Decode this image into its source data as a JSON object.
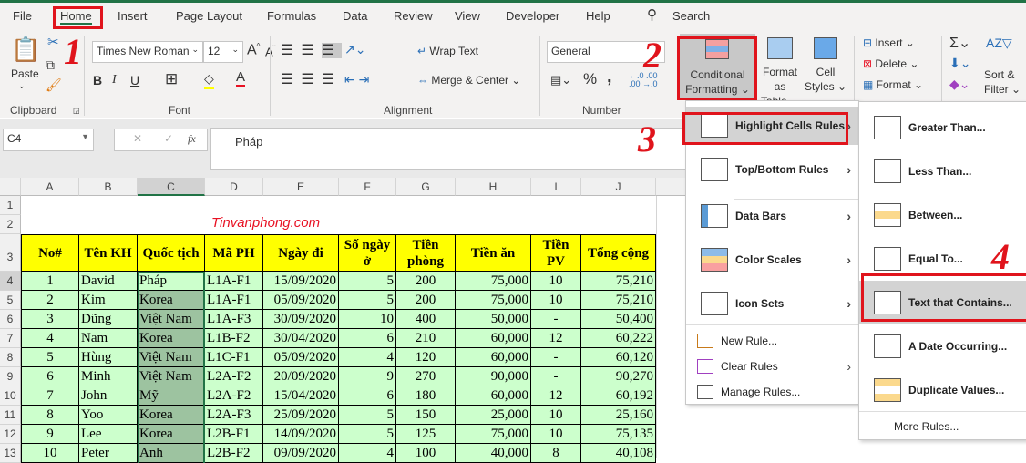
{
  "tabs": [
    "File",
    "Home",
    "Insert",
    "Page Layout",
    "Formulas",
    "Data",
    "Review",
    "View",
    "Developer",
    "Help"
  ],
  "search": "Search",
  "ribbon": {
    "paste": "Paste",
    "clipboard": "Clipboard",
    "font_name": "Times New Roman",
    "font_size": "12",
    "font": "Font",
    "wrap_text": "Wrap Text",
    "merge_center": "Merge & Center",
    "alignment": "Alignment",
    "number_format": "General",
    "number": "Number",
    "conditional_formatting": [
      "Conditional",
      "Formatting"
    ],
    "format_as_table": [
      "Format as",
      "Table"
    ],
    "cell_styles": [
      "Cell",
      "Styles"
    ],
    "insert": "Insert",
    "delete": "Delete",
    "format": "Format",
    "sort_filter": [
      "Sort &",
      "Filter"
    ],
    "bold": "B",
    "italic": "I",
    "underline": "U",
    "percent": "%",
    "comma": ","
  },
  "annotations": [
    "1",
    "2",
    "3",
    "4"
  ],
  "formula_bar": {
    "name_box": "C4",
    "fx": "fx",
    "value": "Pháp"
  },
  "sheet": {
    "columns": [
      "A",
      "B",
      "C",
      "D",
      "E",
      "F",
      "G",
      "H",
      "I",
      "J"
    ],
    "row_numbers": [
      "1",
      "2",
      "3",
      "4",
      "5",
      "6",
      "7",
      "8",
      "9",
      "10",
      "11",
      "12",
      "13"
    ],
    "watermark": "Tinvanphong.com",
    "headers": [
      "No#",
      "Tên KH",
      "Quốc tịch",
      "Mã PH",
      "Ngày đi",
      "Số ngày ở",
      "Tiền phòng",
      "Tiền ăn",
      "Tiền PV",
      "Tổng cộng"
    ],
    "rows": [
      [
        "1",
        "David",
        "Pháp",
        "L1A-F1",
        "15/09/2020",
        "5",
        "200",
        "75,000",
        "10",
        "75,210"
      ],
      [
        "2",
        "Kim",
        "Korea",
        "L1A-F1",
        "05/09/2020",
        "5",
        "200",
        "75,000",
        "10",
        "75,210"
      ],
      [
        "3",
        "Dũng",
        "Việt Nam",
        "L1A-F3",
        "30/09/2020",
        "10",
        "400",
        "50,000",
        "-",
        "50,400"
      ],
      [
        "4",
        "Nam",
        "Korea",
        "L1B-F2",
        "30/04/2020",
        "6",
        "210",
        "60,000",
        "12",
        "60,222"
      ],
      [
        "5",
        "Hùng",
        "Việt Nam",
        "L1C-F1",
        "05/09/2020",
        "4",
        "120",
        "60,000",
        "-",
        "60,120"
      ],
      [
        "6",
        "Minh",
        "Việt Nam",
        "L2A-F2",
        "20/09/2020",
        "9",
        "270",
        "90,000",
        "-",
        "90,270"
      ],
      [
        "7",
        "John",
        "Mỹ",
        "L2A-F2",
        "15/04/2020",
        "6",
        "180",
        "60,000",
        "12",
        "60,192"
      ],
      [
        "8",
        "Yoo",
        "Korea",
        "L2A-F3",
        "25/09/2020",
        "5",
        "150",
        "25,000",
        "10",
        "25,160"
      ],
      [
        "9",
        "Lee",
        "Korea",
        "L2B-F1",
        "14/09/2020",
        "5",
        "125",
        "75,000",
        "10",
        "75,135"
      ],
      [
        "10",
        "Peter",
        "Anh",
        "L2B-F2",
        "09/09/2020",
        "4",
        "100",
        "40,000",
        "8",
        "40,108"
      ]
    ]
  },
  "cf_menu": {
    "items": [
      "Highlight Cells Rules",
      "Top/Bottom Rules",
      "Data Bars",
      "Color Scales",
      "Icon Sets"
    ],
    "small": [
      "New Rule...",
      "Clear Rules",
      "Manage Rules..."
    ]
  },
  "hc_submenu": {
    "items": [
      "Greater Than...",
      "Less Than...",
      "Between...",
      "Equal To...",
      "Text that Contains...",
      "A Date Occurring...",
      "Duplicate Values..."
    ],
    "more": "More Rules..."
  },
  "colors": {
    "accent": "#217346",
    "header_fill": "#ffff00",
    "data_fill": "#ccffcc",
    "annotation": "#e0141c"
  }
}
